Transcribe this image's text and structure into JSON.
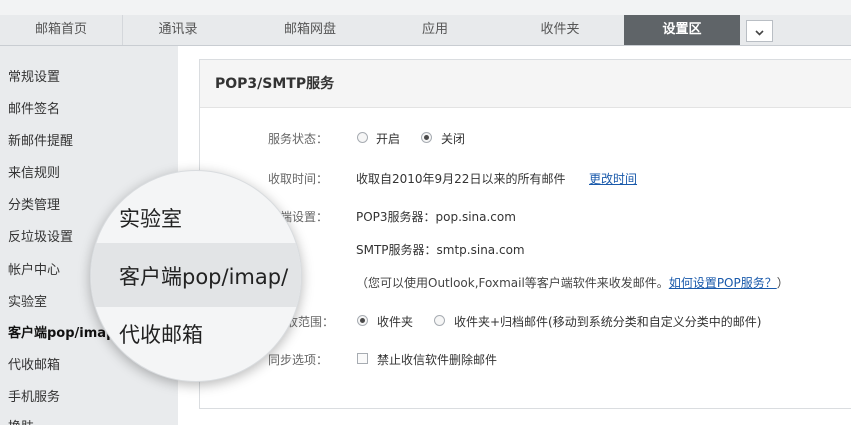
{
  "tabs": [
    {
      "label": "邮箱首页"
    },
    {
      "label": "通讯录"
    },
    {
      "label": "邮箱网盘"
    },
    {
      "label": "应用"
    },
    {
      "label": "收件夹"
    },
    {
      "label": "设置区"
    }
  ],
  "sidebar": {
    "items": [
      {
        "label": "常规设置"
      },
      {
        "label": "邮件签名"
      },
      {
        "label": "新邮件提醒"
      },
      {
        "label": "来信规则"
      },
      {
        "label": "分类管理"
      },
      {
        "label": "反垃圾设置"
      },
      {
        "label": "帐户中心"
      },
      {
        "label": "实验室"
      },
      {
        "label": "客户端pop/imap"
      },
      {
        "label": "代收邮箱"
      },
      {
        "label": "手机服务"
      },
      {
        "label": "换肤"
      }
    ]
  },
  "magnifier": {
    "items": [
      "实验室",
      "客户端pop/imap/",
      "代收邮箱"
    ]
  },
  "panel": {
    "title": "POP3/SMTP服务",
    "status_label": "服务状态：",
    "status_on": "开启",
    "status_off": "关闭",
    "receive_label": "收取时间：",
    "receive_value": "收取自2010年9月22日以来的所有邮件",
    "receive_link": "更改时间",
    "client_label": "户端设置：",
    "pop3": "POP3服务器：pop.sina.com",
    "smtp": "SMTP服务器：smtp.sina.com",
    "tip_prefix": "（您可以使用Outlook,Foxmail等客户端软件来收发邮件。",
    "tip_link": "如何设置POP服务？",
    "tip_suffix": "）",
    "range_label": "收范围：",
    "range_inbox": "收件夹",
    "range_all": "收件夹+归档邮件(移动到系统分类和自定义分类中的邮件)",
    "sync_label": "同步选项：",
    "sync_option": "禁止收信软件删除邮件"
  }
}
